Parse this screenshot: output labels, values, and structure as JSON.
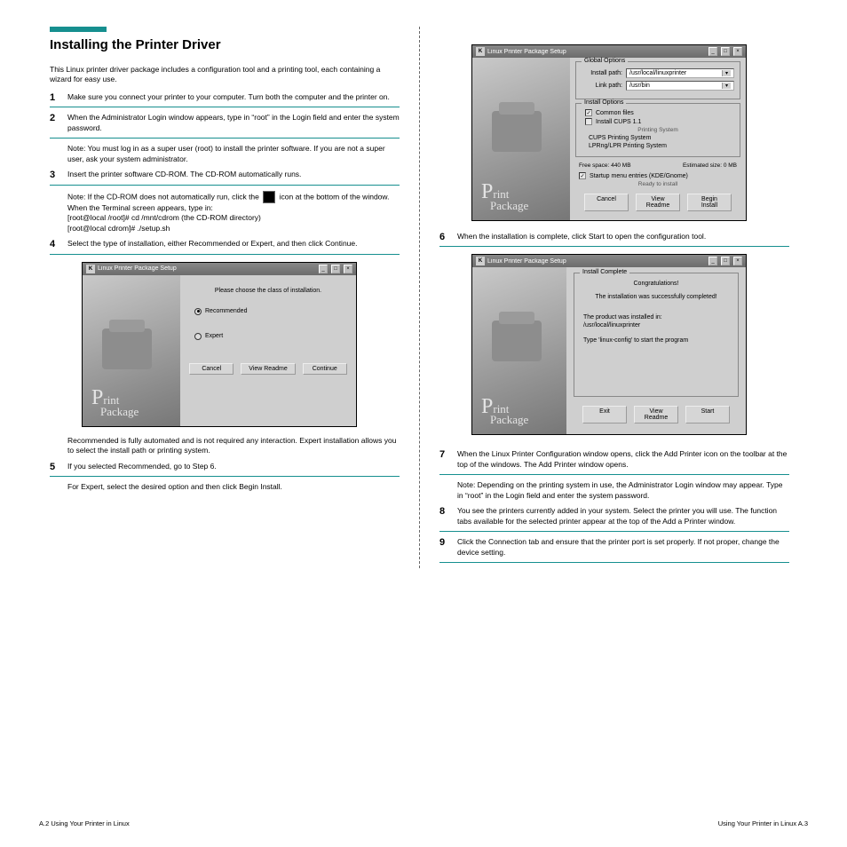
{
  "left": {
    "title": "Installing the Printer Driver",
    "intro": "This Linux printer driver package includes a configuration tool and a printing tool, each containing a wizard for easy use.",
    "steps": {
      "1": "Make sure you connect your printer to your computer. Turn both the computer and the printer on.",
      "2": "When the Administrator Login window appears, type in “root” in the Login field and enter the system password.",
      "2note": "Note: You must log in as a super user (root) to install the printer software. If you are not a super user, ask your system administrator.",
      "3": "Insert the printer software CD-ROM. The CD-ROM automatically runs.",
      "3note": "Note: If the CD-ROM does not automatically run, click the       icon at the bottom of the window. When the Terminal screen appears, type in:\n[root@local /root]# cd /mnt/cdrom (the CD-ROM directory)\n[root@local cdrom]# ./setup.sh",
      "4": "Select the type of installation, either Recommended or Expert, and then click Continue.",
      "5text": "Recommended is fully automated and is not required any interaction. Expert installation allows you to select the install path or printing system.",
      "5": "If you selected Recommended, go to Step 6.",
      "5sub": "For Expert, select the desired option and then click Begin Install."
    }
  },
  "right": {
    "step6": "When the installation is complete, click Start to open the configuration tool.",
    "step7a": "When the Linux Printer Configuration window opens, click the Add Printer icon on the toolbar at the top of the windows. The Add Printer window opens.",
    "step7note": "Note: Depending on the printing system in use, the Administrator Login window may appear. Type in “root” in the Login field and enter the system password.",
    "step8": "You see the printers currently added in your system. Select the printer you will use. The function tabs available for the selected printer appear at the top of the Add a Printer window.",
    "step9": "Click the Connection tab and ensure that the printer port is set properly. If not proper, change the device setting."
  },
  "dlg1": {
    "title": "Linux Printer Package Setup",
    "heading": "Please choose the class of installation.",
    "opt1": "Recommended",
    "opt2": "Expert",
    "b_cancel": "Cancel",
    "b_readme": "View Readme",
    "b_continue": "Continue"
  },
  "dlg2": {
    "title": "Linux Printer Package Setup",
    "gbox_global": "Global Options",
    "lbl_install": "Install path:",
    "val_install": "/usr/local/linuxprinter",
    "lbl_link": "Link path:",
    "val_link": "/usr/bin",
    "gbox_opts": "Install Options",
    "chk1": "Common files",
    "chk2": "Install CUPS 1.1",
    "subhead": "Printing System",
    "radio1": "CUPS Printing System",
    "radio2": "LPRng/LPR Printing System",
    "free_lbl": "Free space:",
    "free_val": "440 MB",
    "est_lbl": "Estimated size:",
    "est_val": "0 MB",
    "chk3": "Startup menu entries (KDE/Gnome)",
    "ready": "Ready to install",
    "b_cancel": "Cancel",
    "b_readme": "View Readme",
    "b_begin": "Begin Install"
  },
  "dlg3": {
    "title": "Linux Printer Package Setup",
    "gbox": "Install Complete",
    "congrats": "Congratulations!",
    "done": "The installation was successfully completed!",
    "installed": "The product was installed in:",
    "installed_path": "/usr/local/linuxprinter",
    "hint": "Type 'linux-config' to start the program",
    "b_exit": "Exit",
    "b_readme": "View Readme",
    "b_start": "Start"
  },
  "footer": {
    "left": "A.2   Using Your Printer in Linux",
    "right": "Using Your Printer in Linux   A.3"
  }
}
